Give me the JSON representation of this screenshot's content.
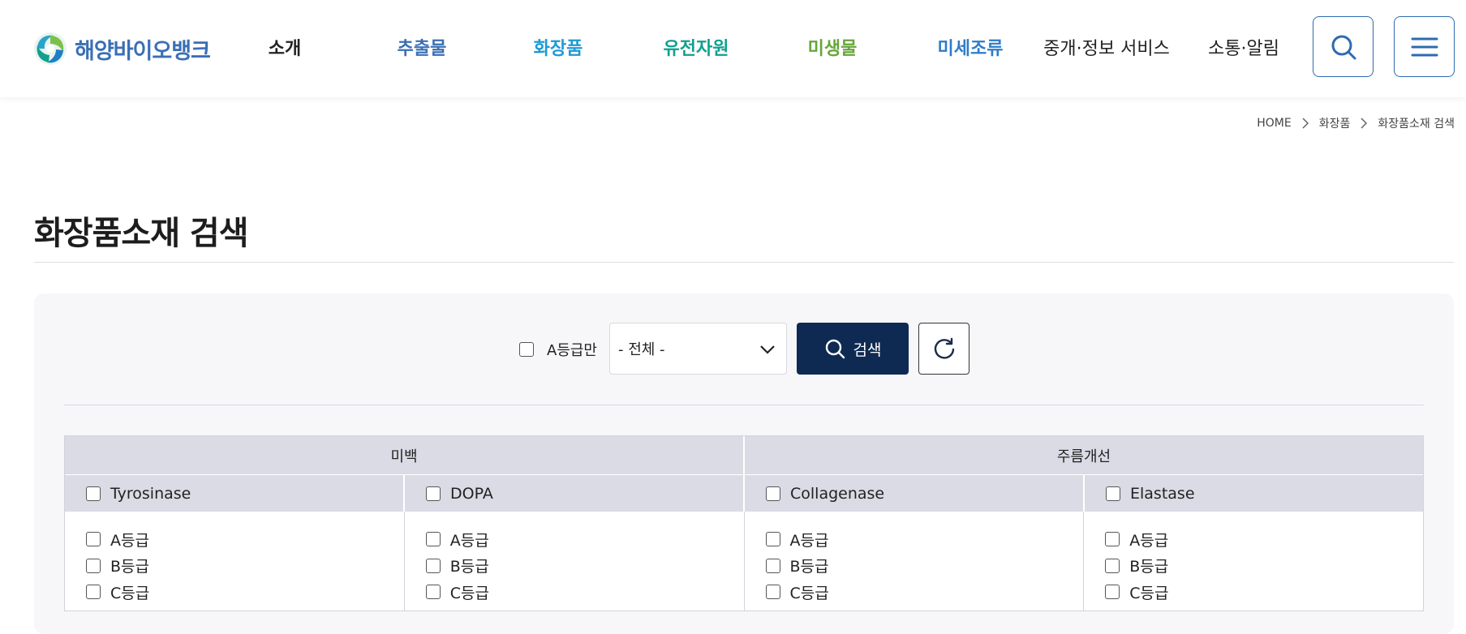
{
  "header": {
    "logo_text": "해양바이오뱅크",
    "nav": [
      {
        "label": "소개",
        "color": "#222222"
      },
      {
        "label": "추출물",
        "color": "#3a6fb5"
      },
      {
        "label": "화장품",
        "color": "#1e9ad6"
      },
      {
        "label": "유전자원",
        "color": "#12a08f"
      },
      {
        "label": "미생물",
        "color": "#66a63a"
      },
      {
        "label": "미세조류",
        "color": "#2f7cc8"
      },
      {
        "label": "중개·정보 서비스",
        "color": "#222222"
      },
      {
        "label": "소통·알림",
        "color": "#222222"
      }
    ],
    "search_icon": "search-icon",
    "menu_icon": "hamburger-menu-icon"
  },
  "breadcrumb": {
    "home": "HOME",
    "level1": "화장품",
    "level2": "화장품소재 검색"
  },
  "page": {
    "title": "화장품소재 검색"
  },
  "search": {
    "a_grade_only_label": "A등급만",
    "select_value": "- 전체 -",
    "search_button_label": "검색",
    "reset_icon": "refresh-icon",
    "accent_color": "#0f2a52"
  },
  "filters": {
    "groups": [
      "미백",
      "주름개선"
    ],
    "enzymes": [
      "Tyrosinase",
      "DOPA",
      "Collagenase",
      "Elastase"
    ],
    "grades": [
      "A등급",
      "B등급",
      "C등급"
    ]
  }
}
